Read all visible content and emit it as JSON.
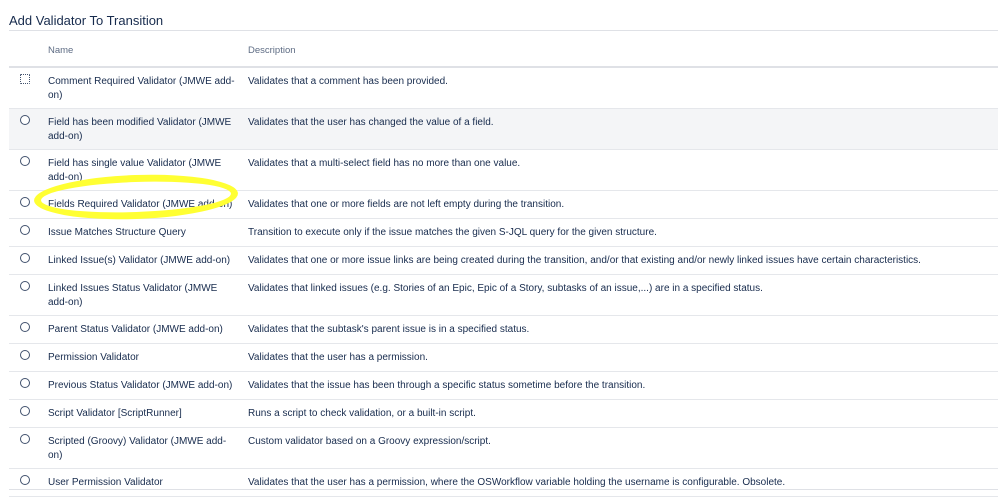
{
  "page": {
    "title": "Add Validator To Transition"
  },
  "table": {
    "headers": {
      "name": "Name",
      "description": "Description"
    },
    "rows": [
      {
        "name": "Comment Required Validator (JMWE add-on)",
        "description": "Validates that a comment has been provided."
      },
      {
        "name": "Field has been modified Validator (JMWE add-on)",
        "description": "Validates that the user has changed the value of a field."
      },
      {
        "name": "Field has single value Validator (JMWE add-on)",
        "description": "Validates that a multi-select field has no more than one value."
      },
      {
        "name": "Fields Required Validator (JMWE add-on)",
        "description": "Validates that one or more fields are not left empty during the transition."
      },
      {
        "name": "Issue Matches Structure Query",
        "description": "Transition to execute only if the issue matches the given S-JQL query for the given structure."
      },
      {
        "name": "Linked Issue(s) Validator (JMWE add-on)",
        "description": "Validates that one or more issue links are being created during the transition, and/or that existing and/or newly linked issues have certain characteristics."
      },
      {
        "name": "Linked Issues Status Validator (JMWE add-on)",
        "description": "Validates that linked issues (e.g. Stories of an Epic, Epic of a Story, subtasks of an issue,...) are in a specified status."
      },
      {
        "name": "Parent Status Validator (JMWE add-on)",
        "description": "Validates that the subtask's parent issue is in a specified status."
      },
      {
        "name": "Permission Validator",
        "description": "Validates that the user has a permission."
      },
      {
        "name": "Previous Status Validator (JMWE add-on)",
        "description": "Validates that the issue has been through a specific status sometime before the transition."
      },
      {
        "name": "Script Validator [ScriptRunner]",
        "description": "Runs a script to check validation, or a built-in script."
      },
      {
        "name": "Scripted (Groovy) Validator (JMWE add-on)",
        "description": "Custom validator based on a Groovy expression/script."
      },
      {
        "name": "User Permission Validator",
        "description": "Validates that the user has a permission, where the OSWorkflow variable holding the username is configurable. Obsolete."
      }
    ]
  },
  "colors": {
    "highlight": "#ffff33",
    "selected_row_bg": "#f4f5f7"
  }
}
